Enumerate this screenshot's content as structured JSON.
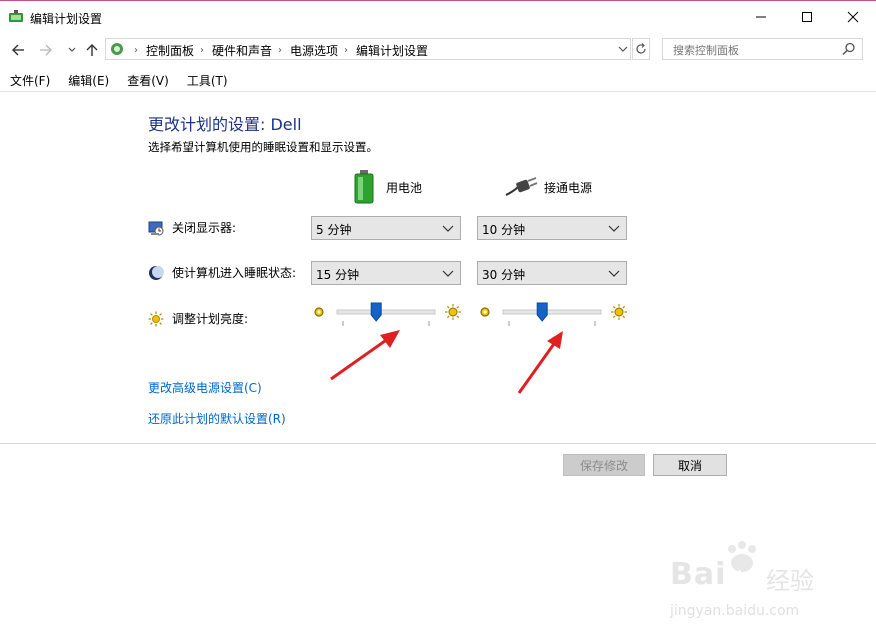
{
  "window": {
    "title": "编辑计划设置"
  },
  "nav": {
    "breadcrumbs": [
      "控制面板",
      "硬件和声音",
      "电源选项",
      "编辑计划设置"
    ],
    "search_placeholder": "搜索控制面板"
  },
  "menu": [
    "文件(F)",
    "编辑(E)",
    "查看(V)",
    "工具(T)"
  ],
  "content": {
    "heading": "更改计划的设置: Dell",
    "subheading": "选择希望计算机使用的睡眠设置和显示设置。",
    "columns": {
      "battery": "用电池",
      "plugged_in": "接通电源"
    },
    "rows": {
      "display": {
        "label": "关闭显示器:",
        "battery": "5 分钟",
        "plugged": "10 分钟"
      },
      "sleep": {
        "label": "使计算机进入睡眠状态:",
        "battery": "15 分钟",
        "plugged": "30 分钟"
      },
      "brightness": {
        "label": "调整计划亮度:",
        "battery_level": 0.4,
        "plugged_level": 0.4
      }
    },
    "links": {
      "advanced": "更改高级电源设置(C)",
      "restore": "还原此计划的默认设置(R)"
    }
  },
  "buttons": {
    "save": "保存修改",
    "cancel": "取消"
  },
  "watermark": {
    "brand": "Bai",
    "paw": "du",
    "cn": "经验",
    "url": "jingyan.baidu.com"
  },
  "colors": {
    "heading": "#1e3287",
    "link": "#0066cc",
    "arrow": "#e02020",
    "slider_thumb": "#1464c8"
  }
}
